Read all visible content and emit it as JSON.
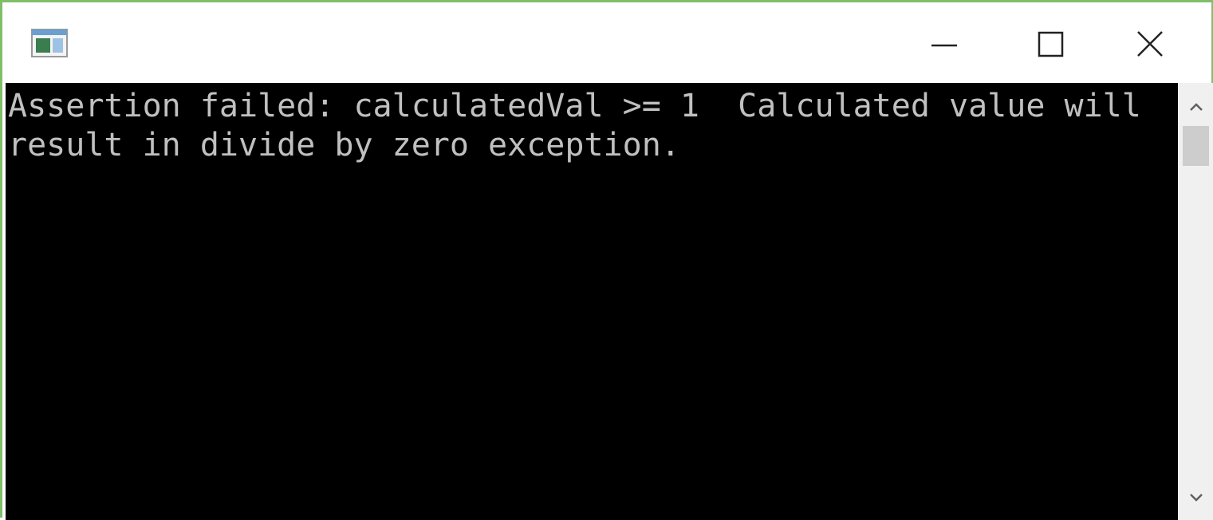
{
  "window": {
    "app_icon": "console-window-icon",
    "controls": {
      "minimize_icon": "minimize-icon",
      "maximize_icon": "maximize-icon",
      "close_icon": "close-icon"
    }
  },
  "console": {
    "lines": [
      "Assertion failed: calculatedVal >= 1  Calculated value will",
      "result in divide by zero exception."
    ],
    "background": "#000000",
    "text_color": "#c0c0c0"
  },
  "scrollbar": {
    "up_icon": "chevron-up-icon",
    "down_icon": "chevron-down-icon"
  },
  "colors": {
    "window_border": "#7fbf6a",
    "titlebar": "#ffffff",
    "scrollbar_track": "#f0f0f0",
    "scrollbar_thumb": "#cdcdcd"
  }
}
